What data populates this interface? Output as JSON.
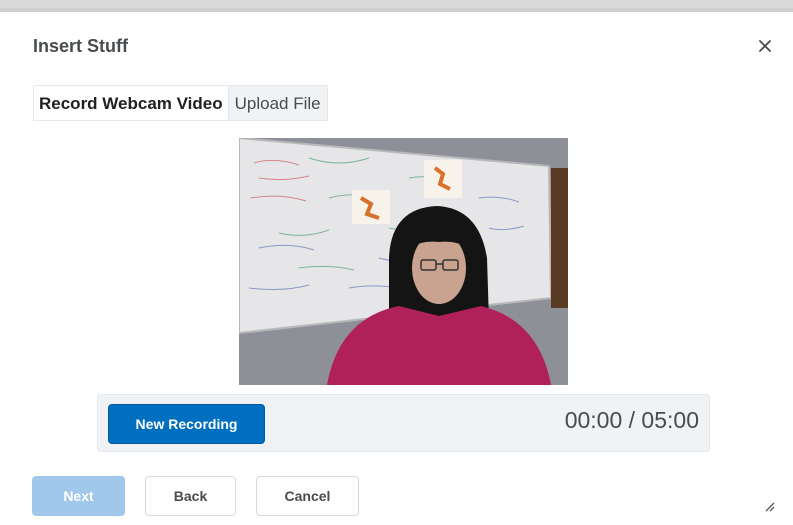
{
  "dialog": {
    "title": "Insert Stuff",
    "close_icon": "close-icon"
  },
  "tabs": [
    {
      "label": "Record Webcam Video",
      "active": true
    },
    {
      "label": "Upload File",
      "active": false
    }
  ],
  "recorder": {
    "new_recording_label": "New Recording",
    "timer": "00:00 / 05:00"
  },
  "footer": {
    "next_label": "Next",
    "back_label": "Back",
    "cancel_label": "Cancel"
  },
  "colors": {
    "primary": "#006fbf",
    "primary_disabled": "#a1c8ea",
    "panel_bg": "#f1f2f3"
  }
}
